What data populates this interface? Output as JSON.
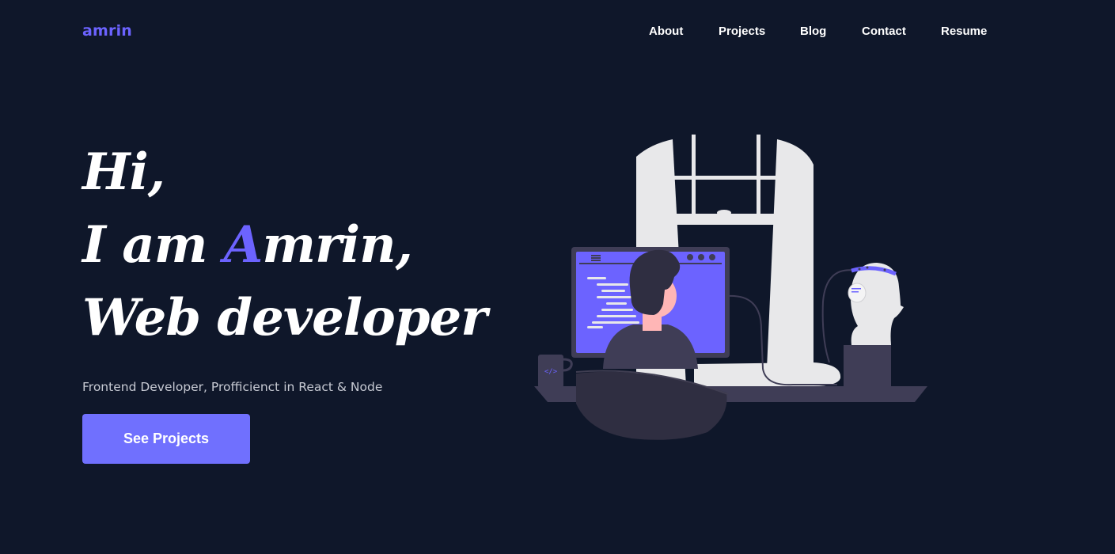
{
  "header": {
    "logo": "amrin",
    "nav": [
      {
        "label": "About"
      },
      {
        "label": "Projects"
      },
      {
        "label": "Blog"
      },
      {
        "label": "Contact"
      },
      {
        "label": "Resume"
      }
    ]
  },
  "hero": {
    "line1": "Hi,",
    "line2_pre": "I am ",
    "line2_accent": "A",
    "line2_post": "mrin,",
    "line3": "Web developer",
    "subtitle": "Frontend Developer, Profficienct in React & Node",
    "cta_label": "See Projects"
  },
  "colors": {
    "background": "#0f172a",
    "accent": "#6c63ff",
    "button": "#7070fe"
  },
  "illustration": {
    "icon": "developer-at-desk-illustration",
    "mug_glyph": "</>"
  }
}
